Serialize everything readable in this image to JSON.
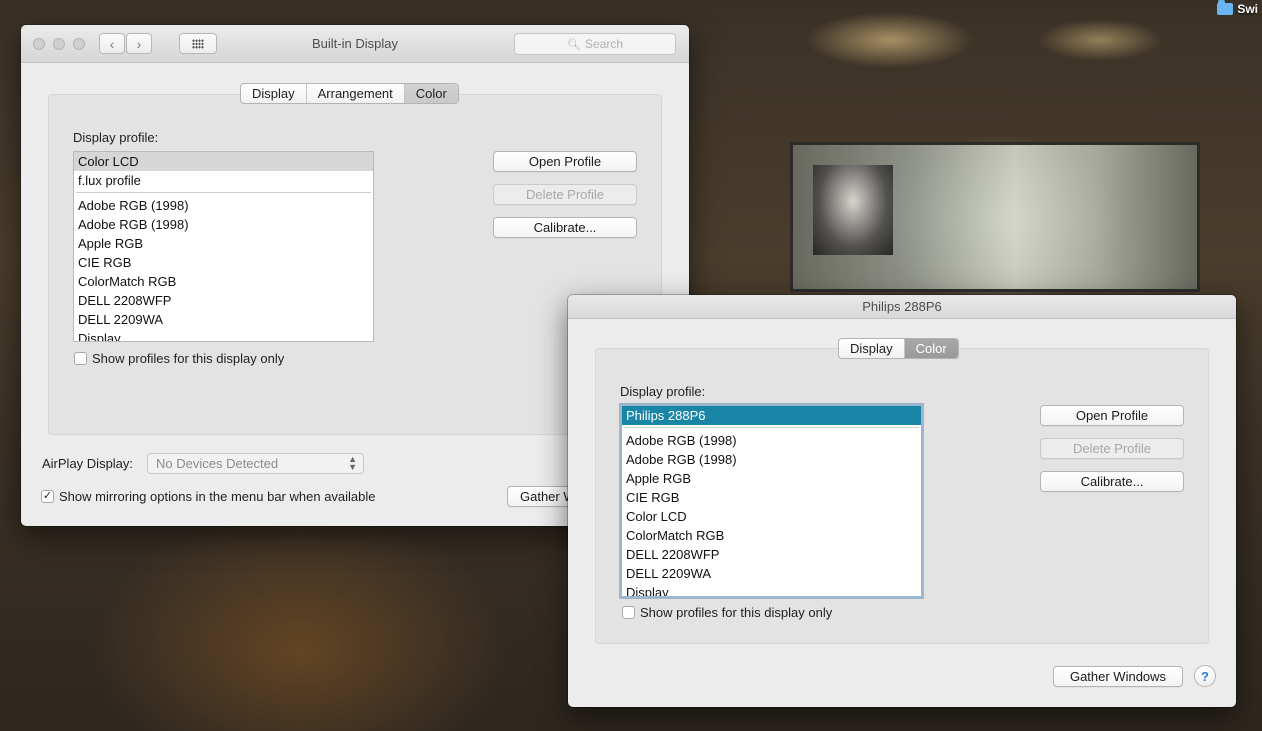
{
  "desktop": {
    "folder_label": "Swi"
  },
  "builtin_window": {
    "title": "Built-in Display",
    "search_placeholder": "Search",
    "back_glyph": "‹",
    "forward_glyph": "›",
    "tabs": [
      "Display",
      "Arrangement",
      "Color"
    ],
    "selected_tab": "Color",
    "display_profile_label": "Display profile:",
    "profiles_top": [
      "Color LCD",
      "f.lux profile"
    ],
    "profiles": [
      "Adobe RGB (1998)",
      "Adobe RGB (1998)",
      "Apple RGB",
      "CIE RGB",
      "ColorMatch RGB",
      "DELL 2208WFP",
      "DELL 2209WA",
      "Display"
    ],
    "selected_profile": "Color LCD",
    "open_profile": "Open Profile",
    "delete_profile": "Delete Profile",
    "calibrate": "Calibrate...",
    "show_profiles_only": "Show profiles for this display only",
    "airplay_label": "AirPlay Display:",
    "airplay_value": "No Devices Detected",
    "mirroring_option": "Show mirroring options in the menu bar when available",
    "mirroring_checked": true,
    "gather_windows_partial": "Gather W"
  },
  "philips_window": {
    "title": "Philips 288P6",
    "tabs": [
      "Display",
      "Color"
    ],
    "selected_tab": "Color",
    "display_profile_label": "Display profile:",
    "profiles_top": [
      "Philips 288P6"
    ],
    "profiles": [
      "Adobe RGB (1998)",
      "Adobe RGB (1998)",
      "Apple RGB",
      "CIE RGB",
      "Color LCD",
      "ColorMatch RGB",
      "DELL 2208WFP",
      "DELL 2209WA",
      "Display"
    ],
    "selected_profile": "Philips 288P6",
    "open_profile": "Open Profile",
    "delete_profile": "Delete Profile",
    "calibrate": "Calibrate...",
    "show_profiles_only": "Show profiles for this display only",
    "gather_windows": "Gather Windows",
    "help": "?"
  },
  "colors": {
    "selection_blue": "#1a86a7",
    "selection_gray": "#d6d6d6",
    "focus_ring": "#9cb6cf"
  }
}
